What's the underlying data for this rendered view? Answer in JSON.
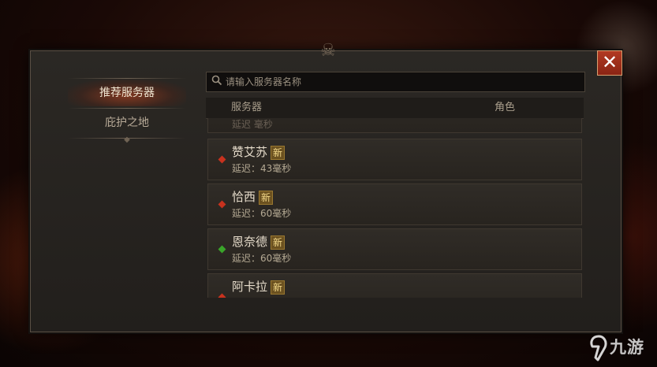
{
  "dialog": {
    "close_label": "✕"
  },
  "nav": {
    "items": [
      {
        "label": "推荐服务器",
        "active": true
      },
      {
        "label": "庇护之地",
        "active": false
      }
    ]
  },
  "search": {
    "placeholder": "请输入服务器名称",
    "value": ""
  },
  "table": {
    "columns": [
      "服务器",
      "角色"
    ]
  },
  "servers": [
    {
      "name": "赞艾苏",
      "badge": "新",
      "latency": "延迟：43毫秒",
      "status_color": "#c8321e"
    },
    {
      "name": "恰西",
      "badge": "新",
      "latency": "延迟：60毫秒",
      "status_color": "#c8321e"
    },
    {
      "name": "恩奈德",
      "badge": "新",
      "latency": "延迟：60毫秒",
      "status_color": "#3aa52a"
    },
    {
      "name": "阿卡拉",
      "badge": "新",
      "latency": "",
      "status_color": "#c8321e"
    }
  ],
  "watermark": {
    "text": "九游"
  }
}
